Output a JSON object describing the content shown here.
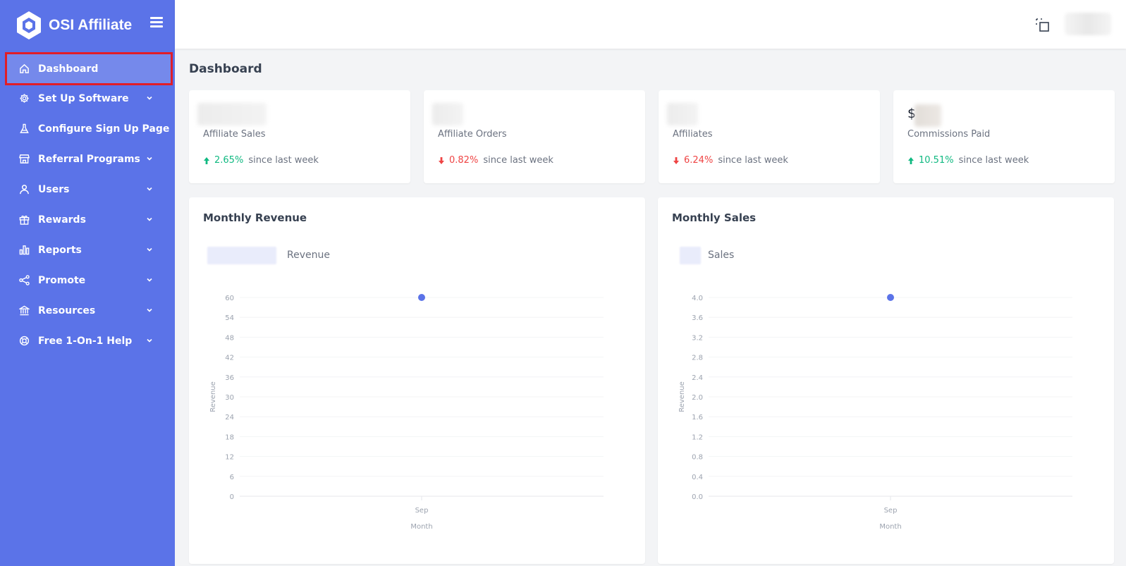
{
  "app": {
    "name": "OSI Affiliate",
    "logo_icon": "hexagon-logo-icon",
    "menu_icon": "hamburger-icon"
  },
  "colors": {
    "sidebar": "#5b73e8",
    "accent": "#5b73e8",
    "positive": "#10b981",
    "negative": "#ef4444",
    "highlight_border": "#e11d27"
  },
  "sidebar": {
    "items": [
      {
        "label": "Dashboard",
        "icon": "home-icon",
        "active": true,
        "expandable": false
      },
      {
        "label": "Set Up Software",
        "icon": "gear-icon",
        "expandable": true
      },
      {
        "label": "Configure Sign Up Page",
        "icon": "flask-icon",
        "expandable": false
      },
      {
        "label": "Referral Programs",
        "icon": "store-icon",
        "expandable": true
      },
      {
        "label": "Users",
        "icon": "user-icon",
        "expandable": true
      },
      {
        "label": "Rewards",
        "icon": "gift-icon",
        "expandable": true
      },
      {
        "label": "Reports",
        "icon": "bar-chart-icon",
        "expandable": true
      },
      {
        "label": "Promote",
        "icon": "share-icon",
        "expandable": true
      },
      {
        "label": "Resources",
        "icon": "bank-icon",
        "expandable": true
      },
      {
        "label": "Free 1-On-1 Help",
        "icon": "lifebuoy-icon",
        "expandable": true
      }
    ]
  },
  "header": {
    "fullscreen_icon": "fullscreen-icon"
  },
  "page": {
    "title": "Dashboard"
  },
  "stats": [
    {
      "label": "Affiliate Sales",
      "change": "2.65%",
      "direction": "up",
      "since": "since last week"
    },
    {
      "label": "Affiliate Orders",
      "change": "0.82%",
      "direction": "down",
      "since": "since last week"
    },
    {
      "label": "Affiliates",
      "change": "6.24%",
      "direction": "down",
      "since": "since last week"
    },
    {
      "label": "Commissions Paid",
      "value_prefix": "$",
      "change": "10.51%",
      "direction": "up",
      "since": "since last week"
    }
  ],
  "charts": {
    "revenue": {
      "title": "Monthly Revenue",
      "legend": "Revenue"
    },
    "sales": {
      "title": "Monthly Sales",
      "legend": "Sales"
    }
  },
  "chart_data": [
    {
      "type": "scatter",
      "title": "Monthly Revenue",
      "legend": [
        "Revenue"
      ],
      "xlabel": "Month",
      "ylabel": "Revenue",
      "categories": [
        "Sep"
      ],
      "series": [
        {
          "name": "Revenue",
          "values": [
            60
          ]
        }
      ],
      "ylim": [
        0,
        60
      ],
      "yticks": [
        "0",
        "6",
        "12",
        "18",
        "24",
        "30",
        "36",
        "42",
        "48",
        "54",
        "60"
      ],
      "grid": true,
      "legend_position": "top-left",
      "color": "#5b73e8"
    },
    {
      "type": "scatter",
      "title": "Monthly Sales",
      "legend": [
        "Sales"
      ],
      "xlabel": "Month",
      "ylabel": "Revenue",
      "categories": [
        "Sep"
      ],
      "series": [
        {
          "name": "Sales",
          "values": [
            4.0
          ]
        }
      ],
      "ylim": [
        0,
        4.0
      ],
      "yticks": [
        "0.0",
        "0.4",
        "0.8",
        "1.2",
        "1.6",
        "2.0",
        "2.4",
        "2.8",
        "3.2",
        "3.6",
        "4.0"
      ],
      "grid": true,
      "legend_position": "top-left",
      "color": "#5b73e8"
    }
  ]
}
